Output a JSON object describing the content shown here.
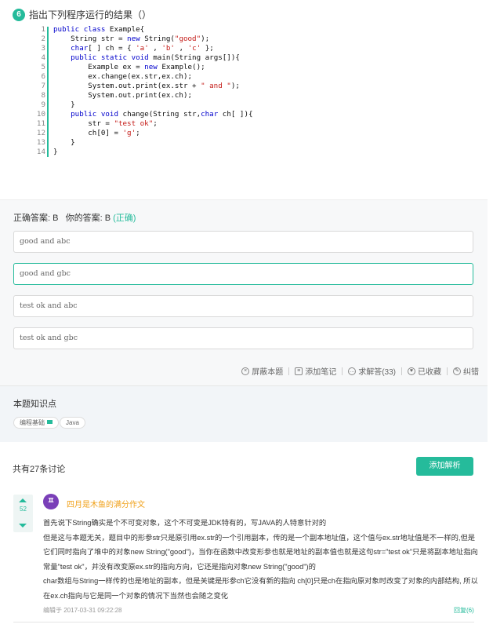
{
  "question": {
    "number": "6",
    "title": "指出下列程序运行的结果（）"
  },
  "code": {
    "line_numbers": [
      "1",
      "2",
      "3",
      "4",
      "5",
      "6",
      "7",
      "8",
      "9",
      "10",
      "11",
      "12",
      "13",
      "14"
    ]
  },
  "answer": {
    "correct_label": "正确答案: B",
    "yours_label": "你的答案: B",
    "status": "(正确)"
  },
  "options": [
    {
      "text": "good and  abc"
    },
    {
      "text": "good and gbc"
    },
    {
      "text": "test ok and abc"
    },
    {
      "text": "test ok and gbc"
    }
  ],
  "actions": {
    "block": "屏蔽本题",
    "note": "添加笔记",
    "ask": "求解答(33)",
    "fav": "已收藏",
    "report": "纠错"
  },
  "knowledge": {
    "title": "本题知识点",
    "tags": [
      "编程基础",
      "Java"
    ]
  },
  "discussion": {
    "count": "共有27条讨论",
    "add_button": "添加解析"
  },
  "comment": {
    "votes": "52",
    "username": "四月是木鱼的满分作文",
    "lines": [
      "首先说下String确实是个不可变对象，这个不可变是JDK特有的，写JAVA的人特意针对的",
      "但是这与本题无关，题目中的形参str只是原引用ex.str的一个引用副本，传的是一个副本地址值，这个值与ex.str地址值是不一样的,但是",
      "它们同时指向了堆中的对象new String(\"good\")，当你在函数中改变形参也就是地址的副本值也就是这句str=\"test ok\"只是将副本地址指向",
      "常量\"test ok\"，并没有改变原ex.str的指向方向，它还是指向对象new String(\"good\")的",
      "char数组与String一样传的也是地址的副本，但是关键是形参ch它没有新的指向 ch[0]只是ch在指向原对象时改变了对象的内部结构, 所以",
      "在ex.ch指向与它是同一个对象的情况下当然也会随之变化"
    ],
    "edited": "编辑于 2017-03-31 09:22:28",
    "reply": "回复(6)"
  },
  "colors": {
    "accent": "#25bb9b",
    "username": "#f0a11a"
  }
}
